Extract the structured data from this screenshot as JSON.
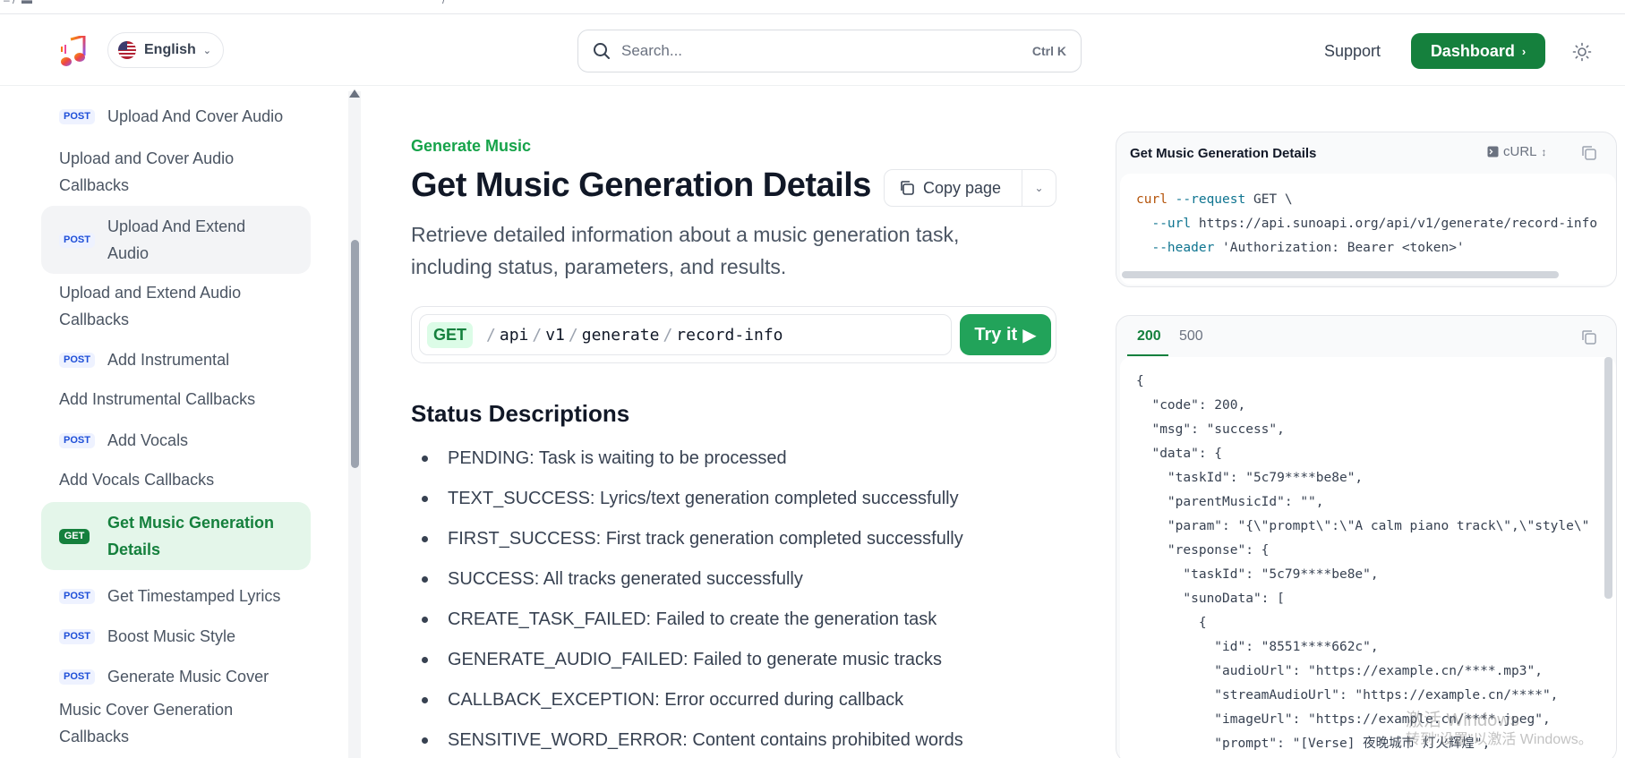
{
  "header": {
    "language": "English",
    "search_placeholder": "Search...",
    "search_shortcut": "Ctrl K",
    "support_label": "Support",
    "dashboard_label": "Dashboard"
  },
  "sidebar": {
    "items": [
      {
        "method": "POST",
        "label": "Upload And Cover Audio"
      },
      {
        "method": "",
        "label": "Upload and Cover Audio Callbacks"
      },
      {
        "method": "POST",
        "label": "Upload And Extend Audio"
      },
      {
        "method": "",
        "label": "Upload and Extend Audio Callbacks"
      },
      {
        "method": "POST",
        "label": "Add Instrumental"
      },
      {
        "method": "",
        "label": "Add Instrumental Callbacks"
      },
      {
        "method": "POST",
        "label": "Add Vocals"
      },
      {
        "method": "",
        "label": "Add Vocals Callbacks"
      },
      {
        "method": "GET",
        "label": "Get Music Generation Details"
      },
      {
        "method": "POST",
        "label": "Get Timestamped Lyrics"
      },
      {
        "method": "POST",
        "label": "Boost Music Style"
      },
      {
        "method": "POST",
        "label": "Generate Music Cover"
      },
      {
        "method": "",
        "label": "Music Cover Generation Callbacks"
      }
    ]
  },
  "main": {
    "breadcrumb": "Generate Music",
    "title": "Get Music Generation Details",
    "copy_page_label": "Copy page",
    "description": "Retrieve detailed information about a music generation task, including status, parameters, and results.",
    "endpoint": {
      "method": "GET",
      "path": [
        "api",
        "v1",
        "generate",
        "record-info"
      ],
      "try_label": "Try it"
    },
    "status_heading": "Status Descriptions",
    "statuses": [
      "PENDING: Task is waiting to be processed",
      "TEXT_SUCCESS: Lyrics/text generation completed successfully",
      "FIRST_SUCCESS: First track generation completed successfully",
      "SUCCESS: All tracks generated successfully",
      "CREATE_TASK_FAILED: Failed to create the generation task",
      "GENERATE_AUDIO_FAILED: Failed to generate music tracks",
      "CALLBACK_EXCEPTION: Error occurred during callback",
      "SENSITIVE_WORD_ERROR: Content contains prohibited words"
    ]
  },
  "request_panel": {
    "title": "Get Music Generation Details",
    "language": "cURL",
    "lines": [
      "curl --request GET \\",
      "  --url https://api.sunoapi.org/api/v1/generate/record-info",
      "  --header 'Authorization: Bearer <token>'"
    ]
  },
  "response_panel": {
    "tabs": [
      "200",
      "500"
    ],
    "lines": [
      "{",
      "  \"code\": 200,",
      "  \"msg\": \"success\",",
      "  \"data\": {",
      "    \"taskId\": \"5c79****be8e\",",
      "    \"parentMusicId\": \"\",",
      "    \"param\": \"{\\\"prompt\\\":\\\"A calm piano track\\\",\\\"style\\\"",
      "    \"response\": {",
      "      \"taskId\": \"5c79****be8e\",",
      "      \"sunoData\": [",
      "        {",
      "          \"id\": \"8551****662c\",",
      "          \"audioUrl\": \"https://example.cn/****.mp3\",",
      "          \"streamAudioUrl\": \"https://example.cn/****\",",
      "          \"imageUrl\": \"https://example.cn/****.jpeg\",",
      "          \"prompt\": \"[Verse] 夜晚城市 灯火辉煌\","
    ]
  },
  "watermark": {
    "line1": "激活 Windows",
    "line2": "转到\"设置\"以激活 Windows。"
  },
  "colors": {
    "accent": "#15803d",
    "try_button": "#22a35a",
    "active_bg": "#e4f6ea"
  }
}
